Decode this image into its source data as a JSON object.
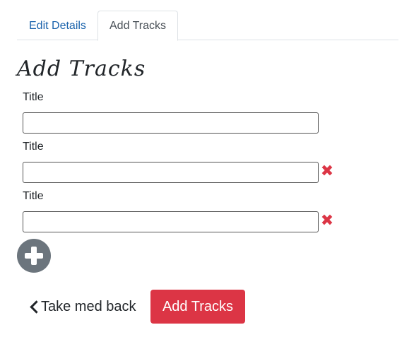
{
  "tabs": [
    {
      "label": "Edit Details",
      "active": false
    },
    {
      "label": "Add Tracks",
      "active": true
    }
  ],
  "heading": "Add Tracks",
  "tracks": [
    {
      "label": "Title",
      "value": "",
      "removable": false
    },
    {
      "label": "Title",
      "value": "",
      "removable": true
    },
    {
      "label": "Title",
      "value": "",
      "removable": true
    }
  ],
  "icons": {
    "remove": "close-icon",
    "add": "plus-circle-icon",
    "back": "chevron-left-icon"
  },
  "colors": {
    "link": "#1c64ad",
    "danger": "#dc3545",
    "secondary": "#6c757d"
  },
  "footer": {
    "back_label": "Take med back",
    "submit_label": "Add Tracks"
  }
}
